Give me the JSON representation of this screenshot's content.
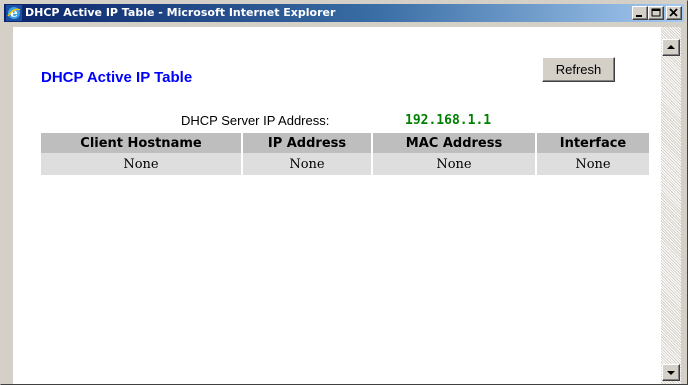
{
  "window": {
    "title": "DHCP Active IP Table - Microsoft Internet Explorer",
    "title_icon": "ie-icon",
    "controls": [
      "minimize-icon",
      "maximize-icon",
      "close-icon"
    ]
  },
  "page": {
    "title": "DHCP Active IP Table",
    "refresh_label": "Refresh",
    "server_ip_label": "DHCP Server IP Address:",
    "server_ip_value": "192.168.1.1"
  },
  "table": {
    "headers": [
      "Client Hostname",
      "IP Address",
      "MAC Address",
      "Interface"
    ],
    "rows": [
      [
        "None",
        "None",
        "None",
        "None"
      ]
    ]
  },
  "colors": {
    "title_text": "#0000ff",
    "server_ip_value": "#008000",
    "header_bg": "#bebebe",
    "row_bg": "#dedede",
    "titlebar_start": "#0a246a",
    "titlebar_end": "#a6caf0"
  }
}
